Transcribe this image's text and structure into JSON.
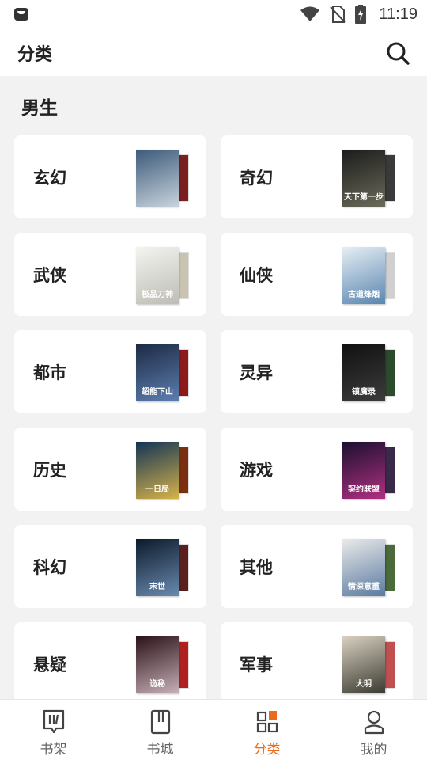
{
  "status_bar": {
    "time": "11:19"
  },
  "header": {
    "title": "分类",
    "search_icon": "search-icon"
  },
  "section": {
    "title": "男生"
  },
  "categories": [
    {
      "label": "玄幻",
      "cover_colors": [
        "#3c5a7a",
        "#c8d3dc"
      ],
      "back_color": "#7a1f1f",
      "cover_text": ""
    },
    {
      "label": "奇幻",
      "cover_colors": [
        "#1c1c1c",
        "#6a6a5a"
      ],
      "back_color": "#3a3a3a",
      "cover_text": "天下第一步"
    },
    {
      "label": "武侠",
      "cover_colors": [
        "#f4f4f0",
        "#bdbdb5"
      ],
      "back_color": "#c9c4b0",
      "cover_text": "极品刀神"
    },
    {
      "label": "仙侠",
      "cover_colors": [
        "#e6eef4",
        "#5a86b0"
      ],
      "back_color": "#d0d0d0",
      "cover_text": "古道烽烟"
    },
    {
      "label": "都市",
      "cover_colors": [
        "#1d2a44",
        "#5c7fb0"
      ],
      "back_color": "#8c1a1a",
      "cover_text": "超能下山"
    },
    {
      "label": "灵异",
      "cover_colors": [
        "#111111",
        "#3c3c3c"
      ],
      "back_color": "#2c4a2c",
      "cover_text": "镇魔录"
    },
    {
      "label": "历史",
      "cover_colors": [
        "#123456",
        "#d6b24a"
      ],
      "back_color": "#7a3010",
      "cover_text": "一日局"
    },
    {
      "label": "游戏",
      "cover_colors": [
        "#1a1030",
        "#b03080"
      ],
      "back_color": "#3a2a4a",
      "cover_text": "契约联盟"
    },
    {
      "label": "科幻",
      "cover_colors": [
        "#0c1a2a",
        "#6a8ab0"
      ],
      "back_color": "#5a2020",
      "cover_text": "末世"
    },
    {
      "label": "其他",
      "cover_colors": [
        "#eaeaea",
        "#5a7aa0"
      ],
      "back_color": "#4a6a3a",
      "cover_text": "情深意重"
    },
    {
      "label": "悬疑",
      "cover_colors": [
        "#2a1218",
        "#c8b0b8"
      ],
      "back_color": "#b02020",
      "cover_text": "诡秘"
    },
    {
      "label": "军事",
      "cover_colors": [
        "#d8d0c0",
        "#3a3a30"
      ],
      "back_color": "#c05050",
      "cover_text": "大明"
    }
  ],
  "bottom_nav": [
    {
      "label": "书架",
      "icon": "bookshelf-icon",
      "active": false
    },
    {
      "label": "书城",
      "icon": "bookstore-icon",
      "active": false
    },
    {
      "label": "分类",
      "icon": "category-icon",
      "active": true
    },
    {
      "label": "我的",
      "icon": "profile-icon",
      "active": false
    }
  ],
  "colors": {
    "accent": "#ea6b1b",
    "background": "#f2f2f2",
    "card": "#ffffff",
    "text": "#222222"
  }
}
